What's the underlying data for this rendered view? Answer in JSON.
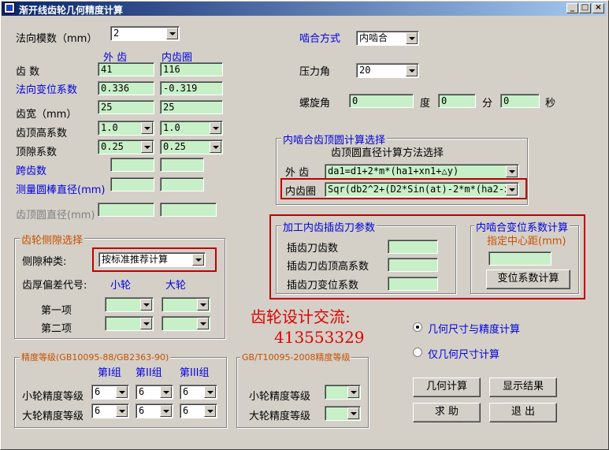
{
  "window": {
    "title": "渐开线齿轮几何精度计算",
    "min": "_",
    "max": "□",
    "close": "×"
  },
  "left": {
    "module_label": "法向模数（mm）",
    "module_value": "2",
    "col_outer": "外 齿",
    "col_inner": "内齿圈",
    "teeth_label": "齿  数",
    "teeth_outer": "41",
    "teeth_inner": "116",
    "shift_label": "法向变位系数",
    "shift_outer": "0.336",
    "shift_inner": "-0.319",
    "width_label": "齿宽（mm）",
    "width_outer": "25",
    "width_inner": "25",
    "addendum_label": "齿顶高系数",
    "addendum_outer": "1.0",
    "addendum_inner": "1.0",
    "clearance_label": "顶隙系数",
    "clearance_outer": "0.25",
    "clearance_inner": "0.25",
    "span_label": "跨齿数",
    "rod_label": "测量圆棒直径(mm)",
    "tipdia_label": "齿顶圆直径(mm)"
  },
  "right": {
    "mesh_label": "啮合方式",
    "mesh_value": "内啮合",
    "pressure_label": "压力角",
    "pressure_value": "20",
    "helix_label": "螺旋角",
    "deg_value": "0",
    "deg_unit": "度",
    "min_value": "0",
    "min_unit": "分",
    "sec_value": "0",
    "sec_unit": "秒"
  },
  "tip": {
    "legend": "内啮合齿顶圆计算选择",
    "subtitle": "齿顶圆直径计算方法选择",
    "outer_label": "外 齿",
    "outer_formula": "da1=d1+2*m*(ha1+xn1+△y)",
    "inner_label": "内齿圈",
    "inner_formula": "Sqr(db2^2+(D2*Sin(at)-2*m*(ha2-x:"
  },
  "cutter": {
    "legend": "加工内齿插齿刀参数",
    "teeth": "插齿刀齿数",
    "addendum": "插齿刀齿顶高系数",
    "shift": "插齿刀变位系数"
  },
  "shiftcalc": {
    "legend": "内啮合变位系数计算",
    "center_label": "指定中心距(mm)",
    "button": "变位系数计算"
  },
  "backlash": {
    "legend": "齿轮侧隙选择",
    "type_label": "侧隙种类:",
    "type_value": "按标准推荐计算",
    "dev_label": "齿厚偏差代号:",
    "small": "小轮",
    "large": "大轮",
    "first": "第一项",
    "second": "第二项"
  },
  "promo": {
    "line1": "齿轮设计交流:",
    "line2": "413553329"
  },
  "mode": {
    "option1": "几何尺寸与精度计算",
    "option2": "仅几何尺寸计算"
  },
  "buttons": {
    "calc": "几何计算",
    "show": "显示结果",
    "help": "求  助",
    "exit": "退  出"
  },
  "accuracy": {
    "legend": "精度等级(GB10095-88/GB2363-90)",
    "g1": "第I组",
    "g2": "第II组",
    "g3": "第III组",
    "small_label": "小轮精度等级",
    "large_label": "大轮精度等级",
    "small": [
      "6",
      "6",
      "6"
    ],
    "large": [
      "6",
      "6",
      "6"
    ]
  },
  "accuracy2": {
    "legend": "GB/T10095-2008精度等级",
    "small_label": "小轮精度等级",
    "large_label": "大轮精度等级"
  }
}
